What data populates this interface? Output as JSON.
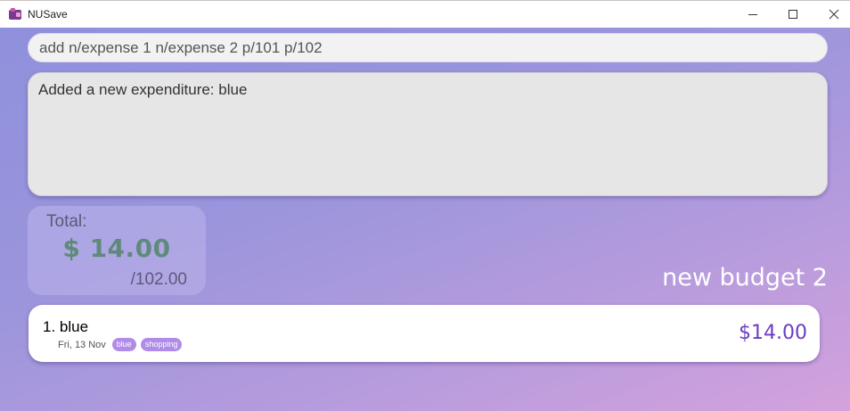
{
  "window": {
    "title": "NUSave",
    "controls": [
      "minimize-icon",
      "maximize-icon",
      "close-icon"
    ]
  },
  "command": {
    "value": "add n/expense 1 n/expense 2 p/101 p/102"
  },
  "result": {
    "text": "Added a new expenditure: blue"
  },
  "total": {
    "label": "Total:",
    "amount": "$ 14.00",
    "budget": "/102.00"
  },
  "budget": {
    "name": "new budget 2"
  },
  "expenditures": [
    {
      "name": "1. blue",
      "date": "Fri, 13 Nov",
      "tags": [
        "blue",
        "shopping"
      ],
      "amount": "$14.00"
    }
  ],
  "colors": {
    "accent": "#6b3ec0",
    "tag": "#b08be8",
    "total_amount": "#5f8a7a"
  }
}
